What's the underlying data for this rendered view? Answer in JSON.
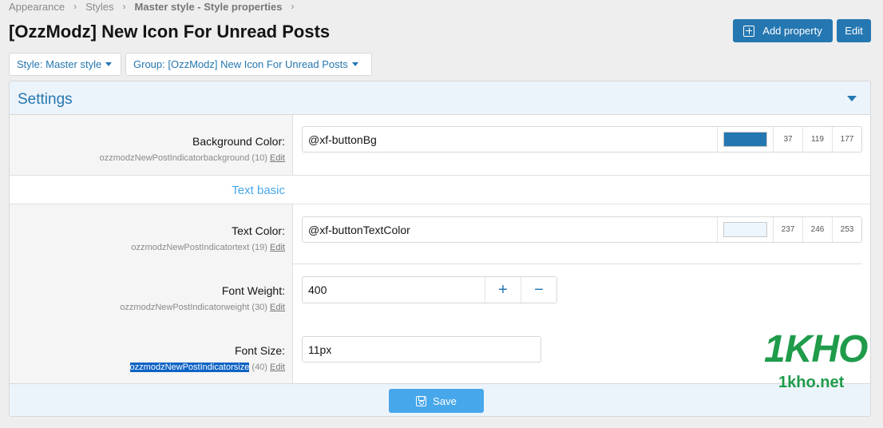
{
  "breadcrumb": {
    "items": [
      "Appearance",
      "Styles",
      "Master style - Style properties"
    ]
  },
  "page": {
    "title": "[OzzModz] New Icon For Unread Posts"
  },
  "actions": {
    "add_property": "Add property",
    "edit": "Edit"
  },
  "filters": {
    "style": "Style: Master style",
    "group": "Group: [OzzModz] New Icon For Unread Posts"
  },
  "panel": {
    "title": "Settings"
  },
  "section": {
    "title": "Text basic"
  },
  "properties": {
    "background_color": {
      "label": "Background Color:",
      "key": "ozzmodzNewPostIndicatorbackground",
      "order": "(10)",
      "edit": "Edit",
      "value": "@xf-buttonBg",
      "swatch": "#2577b1",
      "rgb": [
        "37",
        "119",
        "177"
      ]
    },
    "text_color": {
      "label": "Text Color:",
      "key": "ozzmodzNewPostIndicatortext",
      "order": "(19)",
      "edit": "Edit",
      "value": "@xf-buttonTextColor",
      "swatch": "#edf6fd",
      "rgb": [
        "237",
        "246",
        "253"
      ]
    },
    "font_weight": {
      "label": "Font Weight:",
      "key": "ozzmodzNewPostIndicatorweight",
      "order": "(30)",
      "edit": "Edit",
      "value": "400",
      "plus": "+",
      "minus": "−"
    },
    "font_size": {
      "label": "Font Size:",
      "key": "ozzmodzNewPostIndicatorsize",
      "order": "(40)",
      "edit": "Edit",
      "value": "11px"
    }
  },
  "footer": {
    "save": "Save"
  },
  "watermark": {
    "brand": "1KHO",
    "domain": "1kho.net"
  },
  "colors": {
    "accent": "#2577b1",
    "accent_light": "#47a7eb",
    "header_bg": "#ecf4fb"
  },
  "icons": {
    "add": "plus-square-icon",
    "save": "save-icon",
    "collapse": "caret-down-icon"
  }
}
